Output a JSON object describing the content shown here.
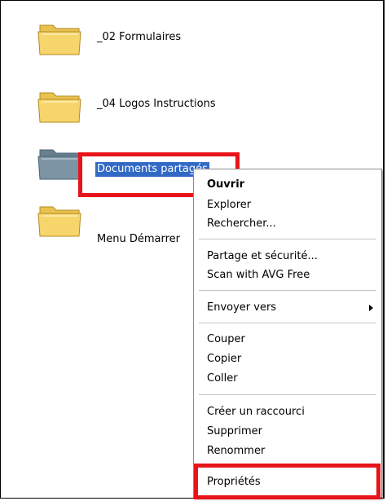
{
  "folders": [
    {
      "label": "_02 Formulaires",
      "icon": "folder-icon"
    },
    {
      "label": "_04 Logos Instructions",
      "icon": "folder-icon"
    },
    {
      "label": "Documents partagés",
      "icon": "shared-folder-icon"
    },
    {
      "label": "Menu Démarrer",
      "icon": "folder-icon"
    }
  ],
  "context_menu": {
    "open": "Ouvrir",
    "explore": "Explorer",
    "search": "Rechercher...",
    "sharing_security": "Partage et sécurité...",
    "scan_avg": "Scan with AVG Free",
    "send_to": "Envoyer vers",
    "cut": "Couper",
    "copy": "Copier",
    "paste": "Coller",
    "create_shortcut": "Créer un raccourci",
    "delete": "Supprimer",
    "rename": "Renommer",
    "properties": "Propriétés"
  },
  "colors": {
    "highlight_box": "#e8141b",
    "selection": "#316ac5",
    "folder_yellow": "#f6d56b",
    "shared_folder_grey": "#7d94a5"
  }
}
